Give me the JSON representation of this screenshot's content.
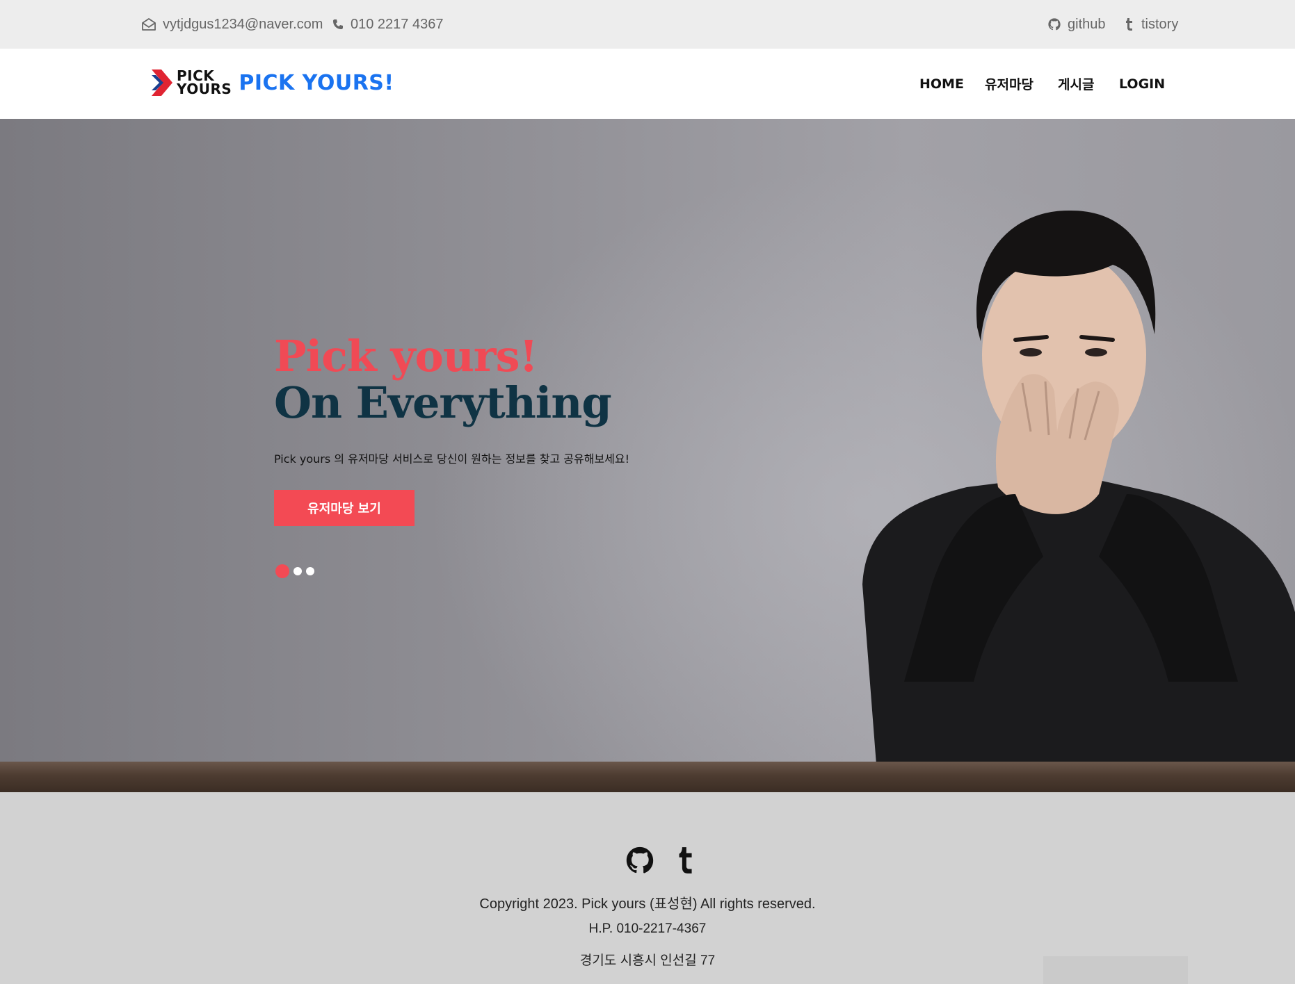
{
  "topbar": {
    "email": "vytjdgus1234@naver.com",
    "phone": "010 2217 4367",
    "github_label": "github",
    "tistory_label": "tistory",
    "icons": [
      "envelope-icon",
      "phone-icon",
      "github-icon",
      "tumblr-icon"
    ]
  },
  "header": {
    "logo_line1": "PICK",
    "logo_line2": "YOURS",
    "brand_title": "PICK YOURS!",
    "nav": [
      "HOME",
      "유저마당",
      "게시글",
      "LOGIN"
    ]
  },
  "hero": {
    "title_line1": "Pick yours!",
    "title_line2": "On Everything",
    "subtitle": "Pick yours 의 유저마당 서비스로 당신이 원하는 정보를 찾고 공유해보세요!",
    "button_label": "유저마당 보기",
    "slides_total": 3,
    "active_slide": 1
  },
  "footer": {
    "copyright": "Copyright 2023. Pick yours (표성현) All rights reserved.",
    "phone": "H.P. 010-2217-4367",
    "address": "경기도 시흥시 인선길 77",
    "icons": [
      "github-icon",
      "tumblr-icon"
    ]
  },
  "colors": {
    "accent_red": "#f34a54",
    "brand_blue": "#1a73f0",
    "navy": "#0f3344",
    "topbar_bg": "#ededed",
    "footer_bg": "#d2d2d2"
  }
}
